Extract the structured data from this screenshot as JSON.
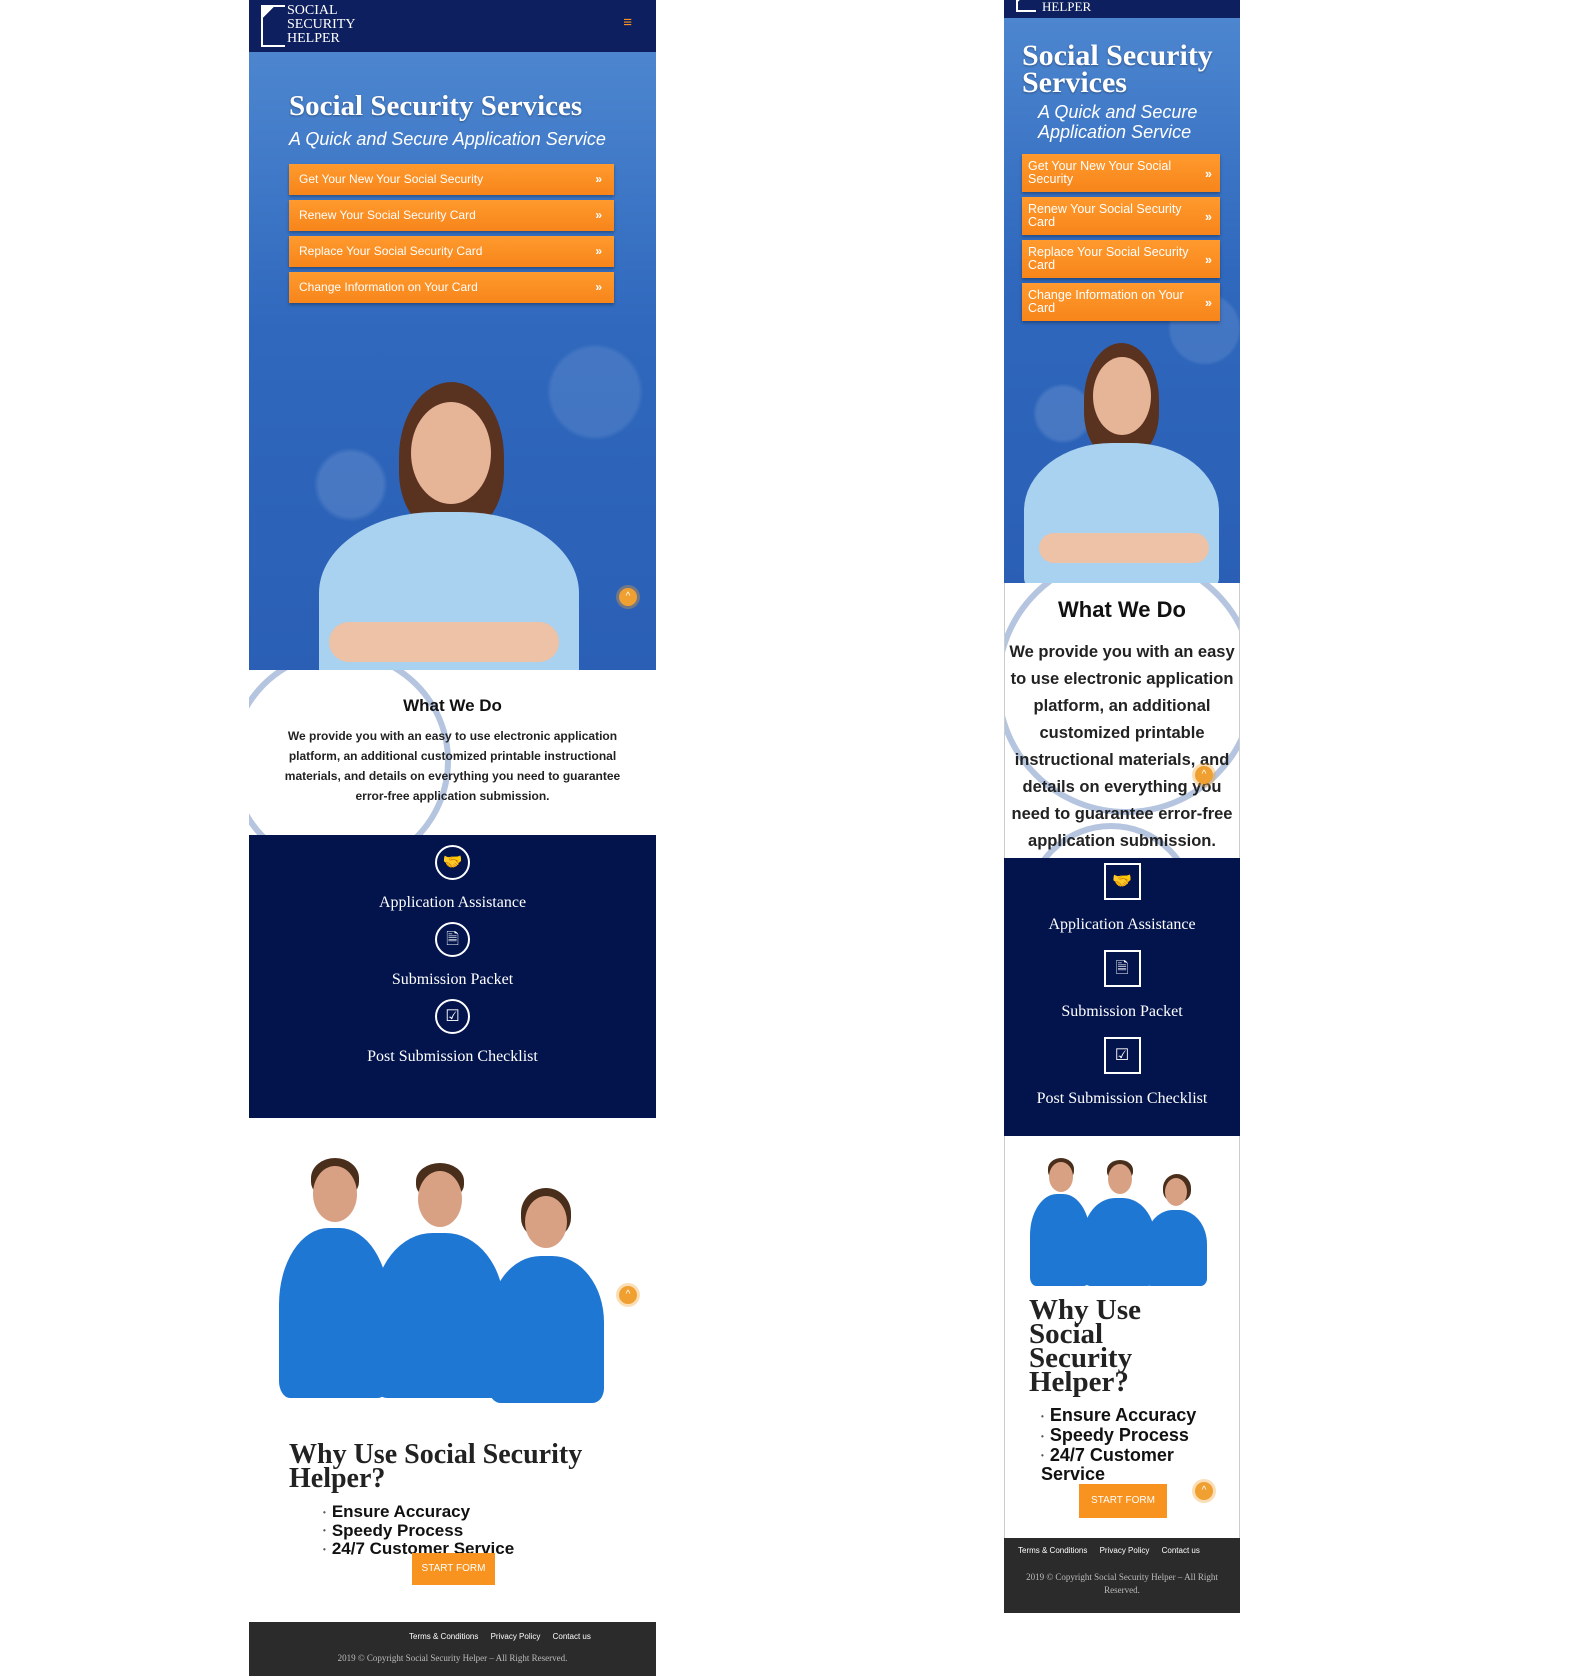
{
  "brand": {
    "line1": "SOCIAL",
    "line2": "SECURITY",
    "line3": "HELPER"
  },
  "header": {
    "menu_icon": "menu-icon",
    "menu_glyph": "≡"
  },
  "hero": {
    "title": "Social Security Services",
    "subtitle": "A Quick and Secure Application Service",
    "buttons": [
      "Get Your New Your Social Security",
      "Renew Your Social Security Card",
      "Replace Your Social Security Card",
      "Change Information on Your Card"
    ],
    "chevron": "»"
  },
  "what_we_do": {
    "heading": "What We Do",
    "text": "We provide you with an easy to use electronic application platform, an additional customized printable instructional materials, and details on everything you need to guarantee error-free application submission."
  },
  "services": [
    {
      "title": "Application Assistance",
      "icon": "handshake-icon",
      "glyph": "🤝"
    },
    {
      "title": "Submission Packet",
      "icon": "document-icon",
      "glyph": "🗎"
    },
    {
      "title": "Post Submission Checklist",
      "icon": "checklist-icon",
      "glyph": "☑"
    }
  ],
  "why": {
    "heading": "Why Use Social Security Helper?",
    "items": [
      "Ensure Accuracy",
      "Speedy Process",
      "24/7 Customer Service"
    ],
    "cta": "START FORM"
  },
  "footer": {
    "links": [
      "Terms & Conditions",
      "Privacy Policy",
      "Contact us"
    ],
    "copyright": "2019 © Copyright Social Security Helper – All Right Reserved."
  },
  "scroll_top_glyph": "^",
  "colors": {
    "navy": "#0d1f5e",
    "dark_navy": "#03144d",
    "orange": "#f7931e",
    "footer": "#2b2b2b"
  }
}
